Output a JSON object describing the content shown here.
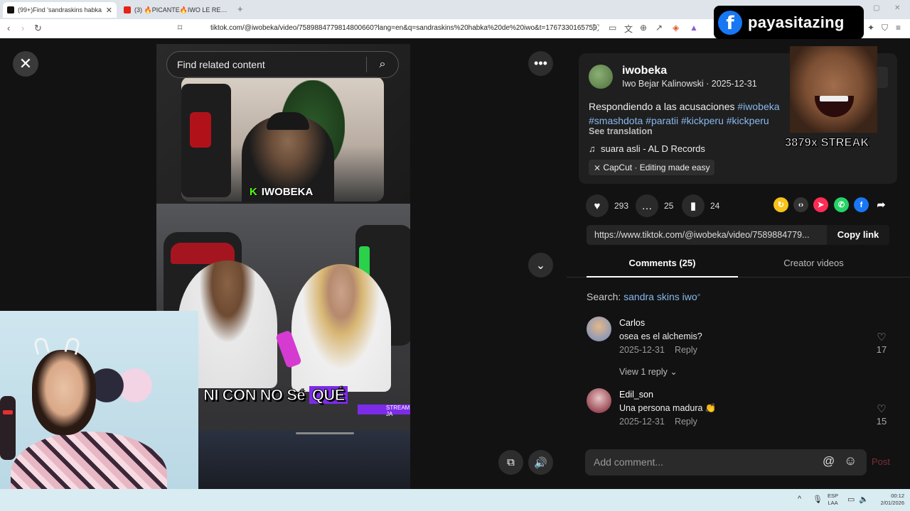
{
  "browser": {
    "tabs": [
      {
        "label": "(99+)Find 'sandraskins habka",
        "close": "✕"
      },
      {
        "label": "(3) 🔥PICANTE🔥IWO LE RESPONDE"
      }
    ],
    "new_tab": "+",
    "url": "tiktok.com/@iwobeka/video/7589884779814800660?lang=en&q=sandraskins%20habka%20de%20iwo&t=1767330165759"
  },
  "video": {
    "search_placeholder": "Find related content",
    "cam_logo_k": "K",
    "cam_logo_name": "IWOBEKA",
    "caption_plain": "NI CON NO Sé ",
    "caption_highlight": "QUÉ",
    "stream_tag": "STREAM JA"
  },
  "post": {
    "username": "iwobeka",
    "subline": "Iwo Bejar Kalinowski · 2025-12-31",
    "desc_text": "Respondiendo a las acusaciones ",
    "desc_tags_line1": "#iwobeka",
    "desc_tags_line2": "#smashdota #paratii #kickperu #kickperu",
    "see_translation": "See translation",
    "music": "suara asli - AL D Records",
    "capcut": "CapCut · Editing made easy",
    "likes": "293",
    "comments_count": "25",
    "saves": "24",
    "share_link": "https://www.tiktok.com/@iwobeka/video/7589884779...",
    "copy_link": "Copy link"
  },
  "comments_panel": {
    "tab_comments": "Comments (25)",
    "tab_creator": "Creator videos",
    "search_label": "Search: ",
    "search_query": "sandra skins iwo",
    "items": [
      {
        "name": "Carlos",
        "text": "osea es el alchemis?",
        "date": "2025-12-31",
        "reply": "Reply",
        "likes": "17",
        "view_replies": "View 1 reply"
      },
      {
        "name": "Edil_son",
        "text": "Una persona madura 👏",
        "date": "2025-12-31",
        "reply": "Reply",
        "likes": "15"
      }
    ],
    "add_comment_placeholder": "Add comment...",
    "post_label": "Post"
  },
  "overlay": {
    "fb_name": "payasitazing",
    "streak": "3879x STREAK"
  },
  "taskbar": {
    "lang_1": "ESP",
    "lang_2": "LAA",
    "time": "00:12",
    "date": "2/01/2026"
  },
  "colors": {
    "accent_link": "#88b8f0",
    "tiktok_bg": "#121212",
    "facebook": "#1877f2",
    "kick_green": "#53fc18"
  }
}
